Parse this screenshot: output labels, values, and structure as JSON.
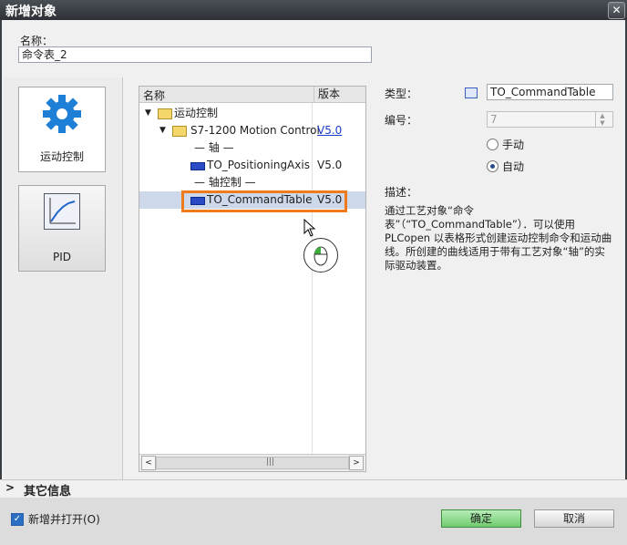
{
  "window": {
    "title": "新增对象",
    "close_glyph": "✕"
  },
  "name": {
    "label": "名称：",
    "value": "命令表_2"
  },
  "categories": [
    {
      "label": "运动控制",
      "icon": "gear-icon",
      "color": "#1e7fd6"
    },
    {
      "label": "PID",
      "icon": "pid-graph-icon"
    }
  ],
  "tree": {
    "headers": {
      "name": "名称",
      "version": "版本"
    },
    "rows": [
      {
        "label": "运动控制",
        "type": "folder"
      },
      {
        "label": "S7-1200 Motion Control",
        "type": "folder",
        "version": "V5.0"
      },
      {
        "label": "— 轴 —",
        "type": "group"
      },
      {
        "label": "TO_PositioningAxis",
        "type": "object",
        "version": "V5.0"
      },
      {
        "label": "— 轴控制 —",
        "type": "group"
      },
      {
        "label": "TO_CommandTable",
        "type": "object",
        "version": "V5.0",
        "selected": true
      }
    ],
    "scroll": {
      "left": "<",
      "right": ">",
      "grip": "|||"
    }
  },
  "properties": {
    "type_label": "类型：",
    "type_value": "TO_CommandTable",
    "number_label": "编号：",
    "number_value": "7",
    "manual_label": "手动",
    "auto_label": "自动",
    "selected_mode": "自动",
    "desc_label": "描述：",
    "description": "通过工艺对象“命令表”（“TO_CommandTable”）．可以使用 PLCopen 以表格形式创建运动控制命令和运动曲线。所创建的曲线适用于带有工艺对象“轴”的实际驱动装置。"
  },
  "more_info": {
    "label": "其它信息",
    "arrow": ">"
  },
  "footer": {
    "open_label": "新增并打开(O)",
    "open_checked": true,
    "ok_label": "确定",
    "cancel_label": "取消"
  },
  "colors": {
    "highlight": "#ee7b1c",
    "ok_button": "#6fcb6f",
    "link": "#1a3fcc"
  }
}
